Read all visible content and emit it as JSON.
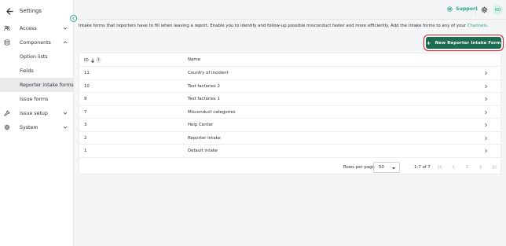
{
  "sidebar": {
    "back_label": "Settings",
    "items": [
      {
        "label": "Access",
        "icon": "people-icon",
        "expanded": false
      },
      {
        "label": "Components",
        "icon": "database-icon",
        "expanded": true
      },
      {
        "label": "Option lists"
      },
      {
        "label": "Fields"
      },
      {
        "label": "Reporter intake forms",
        "active": true
      },
      {
        "label": "Issue forms"
      },
      {
        "label": "Issue setup",
        "icon": "wrench-icon",
        "expanded": false
      },
      {
        "label": "System",
        "icon": "gear-icon",
        "expanded": false
      }
    ]
  },
  "topbar": {
    "support_label": "Support",
    "avatar_initials": "KD"
  },
  "main": {
    "description": "Intake forms that reporters have to fill when leaving a report. Enable you to identify and follow-up possible misconduct faster and more efficiently. Add the intake forms to any of your ",
    "description_link": "Channels",
    "description_end": ".",
    "new_button_label": "New Reporter Intake Form"
  },
  "table": {
    "columns": {
      "id": "ID",
      "name": "Name"
    },
    "sort_badge": "1",
    "rows": [
      {
        "id": "11",
        "name": "Country of incident"
      },
      {
        "id": "10",
        "name": "Test factories 2"
      },
      {
        "id": "9",
        "name": "Test factories 1"
      },
      {
        "id": "7",
        "name": "Misconduct categories"
      },
      {
        "id": "3",
        "name": "Help Center"
      },
      {
        "id": "2",
        "name": "Reporter Intake"
      },
      {
        "id": "1",
        "name": "Default intake"
      }
    ]
  },
  "pagination": {
    "rows_per_page_label": "Rows per page",
    "rows_per_page_value": "50",
    "range": "1-7 of 7",
    "page": "1"
  },
  "colors": {
    "accent": "#2aa889",
    "button_bg": "#1e6b52",
    "highlight_ring": "#d61f2c"
  }
}
